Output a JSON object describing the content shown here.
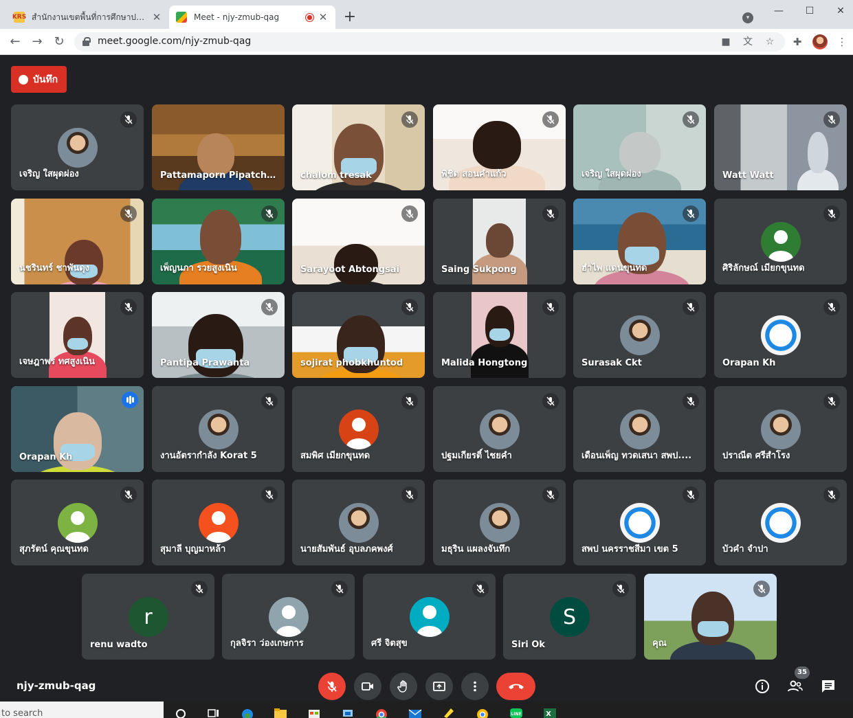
{
  "browser": {
    "tabs": [
      {
        "title": "สำนักงานเขตพื้นที่การศึกษาประถมศึกษา",
        "favicon": "KRS"
      },
      {
        "title": "Meet - njy-zmub-qag",
        "recording": true
      }
    ],
    "url": "meet.google.com/njy-zmub-qag"
  },
  "meeting": {
    "record_label": "บันทึก",
    "code": "njy-zmub-qag",
    "participant_count": "35"
  },
  "participants": [
    {
      "name": "เจริญ ใสผุดผ่อง",
      "kind": "avatar-photo",
      "muted": true
    },
    {
      "name": "Pattamaporn Pipatcho...",
      "kind": "video",
      "muted": false
    },
    {
      "name": "chalom tresak",
      "kind": "video",
      "muted": true
    },
    {
      "name": "พิชิต สอนคำแก้ว",
      "kind": "video",
      "muted": true
    },
    {
      "name": "เจริญ ใสผุดผ่อง",
      "kind": "video",
      "muted": true
    },
    {
      "name": "Watt Watt",
      "kind": "video",
      "muted": true
    },
    {
      "name": "นชรินทร์ ชาพันดุง",
      "kind": "video",
      "muted": true
    },
    {
      "name": "เพ็ญนภา รวยสูงเนิน",
      "kind": "video",
      "muted": true
    },
    {
      "name": "Sarayoot Abtongsai",
      "kind": "video",
      "muted": true
    },
    {
      "name": "Saing Sukpong",
      "kind": "video",
      "muted": true
    },
    {
      "name": "ฮำไพ แดนขุนทด",
      "kind": "video",
      "muted": true
    },
    {
      "name": "ศิริลักษณ์ เมียกขุนทด",
      "kind": "avatar",
      "color": "#2e7d32",
      "muted": true
    },
    {
      "name": "เจษฎาพร ทศสูงเนิน",
      "kind": "video",
      "muted": true
    },
    {
      "name": "Pantipa Prawanta",
      "kind": "video",
      "muted": true
    },
    {
      "name": "sojirat phobkhuntod",
      "kind": "video",
      "muted": true
    },
    {
      "name": "Malida Hongtong",
      "kind": "video",
      "muted": true
    },
    {
      "name": "Surasak Ckt",
      "kind": "avatar-photo",
      "muted": true
    },
    {
      "name": "Orapan Kh",
      "kind": "avatar-logo",
      "muted": true
    },
    {
      "name": "Orapan Kh",
      "kind": "video",
      "speaking": true,
      "muted": false
    },
    {
      "name": "งานอัตรากำลัง Korat 5",
      "kind": "avatar-photo",
      "muted": true
    },
    {
      "name": "สมพิศ เมียกขุนทด",
      "kind": "avatar",
      "color": "#d84315",
      "muted": true
    },
    {
      "name": "ปฐมเกียรติ์ ไชยคำ",
      "kind": "avatar-photo",
      "muted": true
    },
    {
      "name": "เดือนเพ็ญ ทวดเสนา สพป....",
      "kind": "avatar-photo",
      "muted": true
    },
    {
      "name": "ปราณีต ศรีสำโรง",
      "kind": "avatar-photo",
      "muted": true
    },
    {
      "name": "สุภรัตน์ คุณขุนทด",
      "kind": "avatar",
      "color": "#7cb342",
      "muted": true
    },
    {
      "name": "สุมาลี บุญมาหล้า",
      "kind": "avatar",
      "color": "#f4511e",
      "muted": true
    },
    {
      "name": "นายสัมพันธ์ อุบลภคพงศ์",
      "kind": "avatar-photo",
      "muted": true
    },
    {
      "name": "มธุริน แผลงจันทึก",
      "kind": "avatar-photo",
      "muted": true
    },
    {
      "name": "สพป นครราชสีมา เขต 5",
      "kind": "avatar-logo",
      "muted": true
    },
    {
      "name": "บัวคำ จำปา",
      "kind": "avatar-logo",
      "muted": true
    },
    {
      "name": "renu wadto",
      "kind": "avatar-letter",
      "letter": "r",
      "color": "#1e5631",
      "muted": true
    },
    {
      "name": "กุลจิรา ว่องเกษการ",
      "kind": "avatar",
      "color": "#90a4ae",
      "muted": true
    },
    {
      "name": "ศรี จิตสุข",
      "kind": "avatar",
      "color": "#00acc1",
      "muted": true
    },
    {
      "name": "Siri Ok",
      "kind": "avatar-letter",
      "letter": "S",
      "color": "#004d40",
      "muted": true
    },
    {
      "name": "คุณ",
      "kind": "video",
      "muted": true
    }
  ],
  "taskbar": {
    "search_placeholder": "to search"
  },
  "colors": {
    "accent": "#8ab4f8",
    "danger": "#ea4335",
    "tile": "#3c4043",
    "background": "#202124"
  }
}
